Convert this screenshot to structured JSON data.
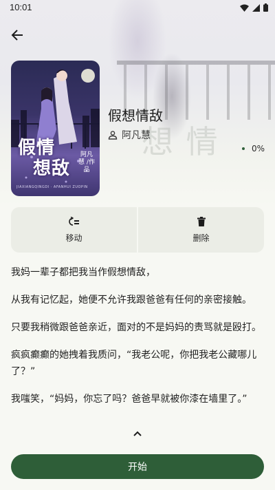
{
  "status_bar": {
    "time": "10:01"
  },
  "book": {
    "title": "假想情敌",
    "author": "阿凡慧",
    "progress": "0%",
    "cover": {
      "title_line1": "假情",
      "title_line2": "想敌",
      "author_tag": "阿凡慧 /作品",
      "tagline": "JIAXIANGQINGDI · AFANHUI ZUOPIN"
    }
  },
  "actions": [
    {
      "label": "移动",
      "icon": "move-icon"
    },
    {
      "label": "删除",
      "icon": "trash-icon"
    }
  ],
  "description": [
    "我妈一辈子都把我当作假想情敌，",
    "从我有记忆起，她便不允许我跟爸爸有任何的亲密接触。",
    "只要我稍微跟爸爸亲近，面对的不是妈妈的责骂就是殴打。",
    "疯疯癫癫的她拽着我质问，“我老公呢，你把我老公藏哪儿了？”",
    "我嗤笑，“妈妈，你忘了吗？爸爸早就被你漆在墙里了。”"
  ],
  "start_button": "开始",
  "colors": {
    "accent": "#2e5e38",
    "background": "#f7f8f3",
    "card": "#ebede6"
  }
}
